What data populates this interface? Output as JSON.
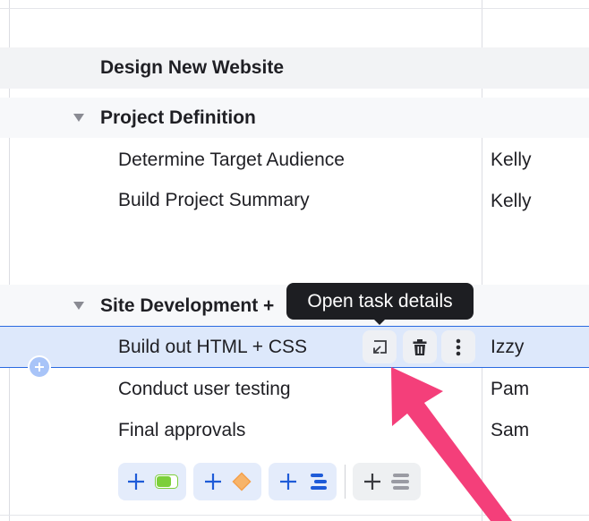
{
  "project": {
    "title": "Design New Website"
  },
  "groups": [
    {
      "name": "Project Definition",
      "tasks": [
        {
          "name": "Determine Target Audience",
          "assignee": "Kelly"
        },
        {
          "name": "Build Project Summary",
          "assignee": "Kelly"
        }
      ]
    },
    {
      "name": "Site Development +",
      "tasks": [
        {
          "name": "Build out HTML + CSS",
          "assignee": "Izzy"
        },
        {
          "name": "Conduct user testing",
          "assignee": "Pam"
        },
        {
          "name": "Final approvals",
          "assignee": "Sam"
        }
      ]
    }
  ],
  "tooltip": {
    "text": "Open task details"
  },
  "row_actions": [
    "open-task-details-icon",
    "trash-icon",
    "more-vertical-icon"
  ],
  "add_toolbar": [
    "add-task-toggle",
    "add-milestone",
    "add-subtask-list",
    "add-text-row"
  ],
  "colors": {
    "selection_border": "#2a6ae0",
    "selection_bg": "#dde8fb",
    "accent_blue": "#1e5bd8",
    "toggle_green": "#7ccf3a",
    "diamond_orange": "#f5a04a",
    "arrow_pink": "#f43f7a"
  }
}
